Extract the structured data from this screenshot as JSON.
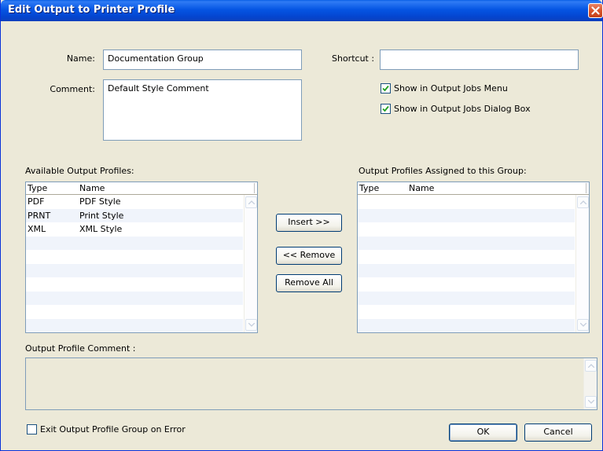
{
  "window": {
    "title": "Edit Output to Printer Profile"
  },
  "form": {
    "name_label": "Name:",
    "name_value": "Documentation Group",
    "comment_label": "Comment:",
    "comment_value": "Default Style Comment",
    "shortcut_label": "Shortcut :",
    "shortcut_value": "",
    "show_menu_label": "Show in Output Jobs Menu",
    "show_menu_checked": true,
    "show_dialog_label": "Show in Output Jobs Dialog Box",
    "show_dialog_checked": true
  },
  "available": {
    "label": "Available Output Profiles:",
    "col_type": "Type",
    "col_name": "Name",
    "rows": [
      {
        "type": "PDF",
        "name": "PDF Style"
      },
      {
        "type": "PRNT",
        "name": "Print Style"
      },
      {
        "type": "XML",
        "name": "XML Style"
      }
    ]
  },
  "assigned": {
    "label": "Output Profiles Assigned to this Group:",
    "col_type": "Type",
    "col_name": "Name",
    "rows": []
  },
  "actions": {
    "insert_label": "Insert >>",
    "remove_label": "<< Remove",
    "remove_all_label": "Remove All"
  },
  "profile_comment": {
    "label": "Output Profile Comment :",
    "value": ""
  },
  "exit_on_error": {
    "label": "Exit Output Profile Group on Error",
    "checked": false
  },
  "footer": {
    "ok_label": "OK",
    "cancel_label": "Cancel"
  },
  "icons": {
    "close": "close-icon",
    "check": "checkmark-icon",
    "scroll_up": "scroll-up-arrow-icon",
    "scroll_down": "scroll-down-arrow-icon"
  },
  "colors": {
    "titlebar": "#0555e3",
    "dialog_bg": "#ece9d8",
    "field_border": "#7f9db9",
    "close_button": "#d9542b"
  }
}
